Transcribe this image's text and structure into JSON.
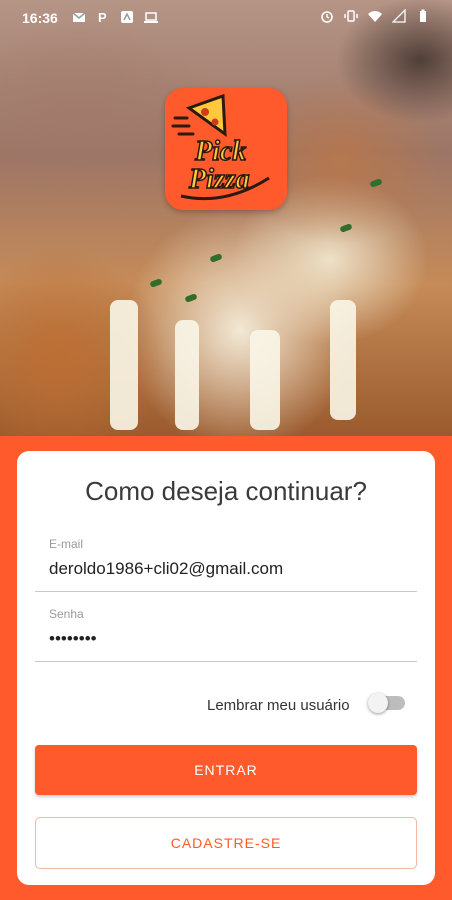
{
  "status_bar": {
    "time": "16:36",
    "left_icons": [
      "gmail-icon",
      "paypal-icon",
      "app-icon",
      "laptop-icon"
    ],
    "right_icons": [
      "alarm-icon",
      "vibrate-icon",
      "wifi-icon",
      "signal-icon",
      "battery-icon"
    ]
  },
  "logo": {
    "line1": "Pick",
    "line2": "Pizza"
  },
  "login": {
    "title": "Como deseja continuar?",
    "email_label": "E-mail",
    "email_value": "deroldo1986+cli02@gmail.com",
    "password_label": "Senha",
    "password_value": "••••••••",
    "remember_label": "Lembrar meu usuário",
    "remember_enabled": false,
    "submit_label": "ENTRAR",
    "register_label": "CADASTRE-SE"
  },
  "colors": {
    "accent": "#ff5a2b",
    "logo_yellow": "#ffc83d"
  }
}
